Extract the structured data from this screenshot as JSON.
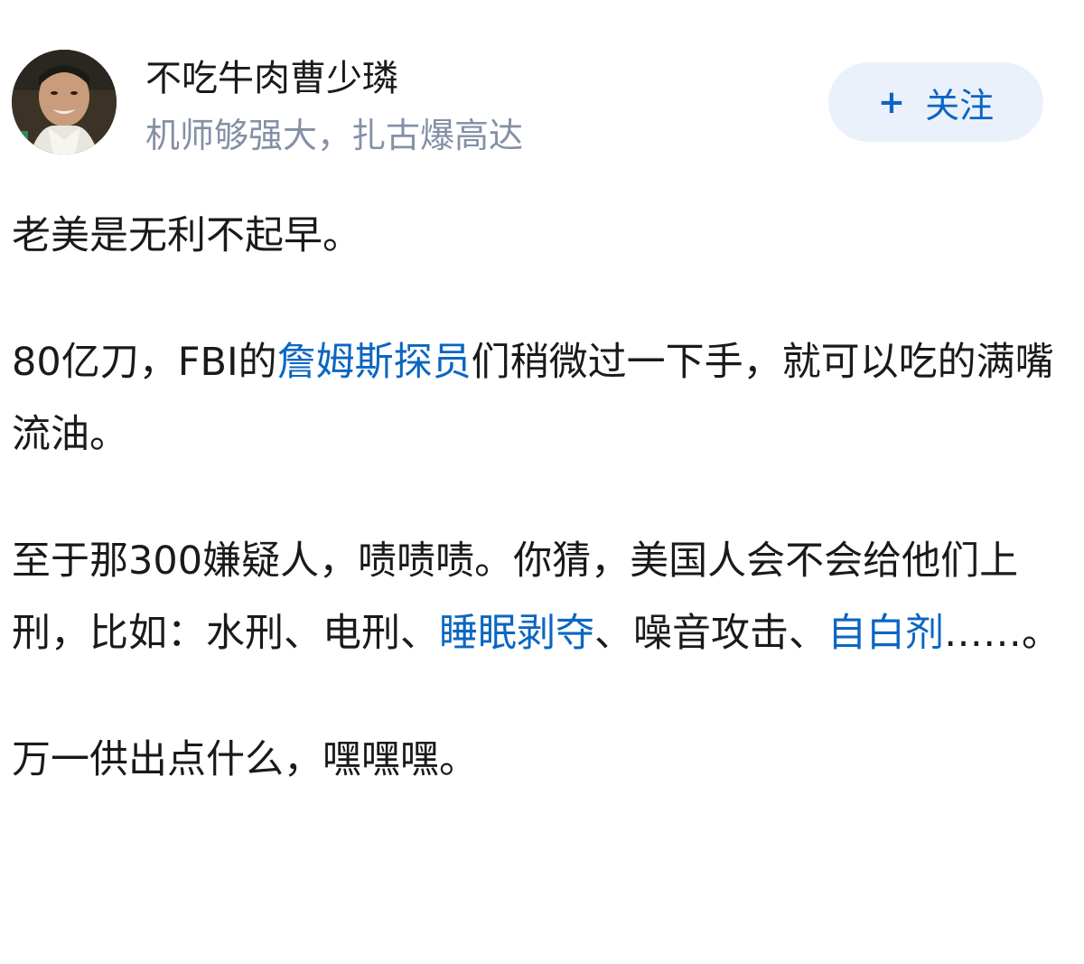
{
  "author": {
    "name": "不吃牛肉曹少璘",
    "bio": "机师够强大，扎古爆高达"
  },
  "follow_button": {
    "plus": "+",
    "label": "关注"
  },
  "colors": {
    "link": "#0a66c2",
    "follow_bg": "#ebf1fb",
    "bio_text": "#8590a6",
    "body_text": "#1a1a1a"
  },
  "answer": {
    "p1": "老美是无利不起早。",
    "p2": {
      "pre": "80亿刀，FBI的",
      "link1": "詹姆斯探员",
      "post": "们稍微过一下手，就可以吃的满嘴流油。"
    },
    "p3": {
      "seg1": "至于那300嫌疑人，啧啧啧。你猜，美国人会不会给他们上刑，比如：水刑、电刑、",
      "link1": "睡眠剥夺",
      "seg2": "、噪音攻击、",
      "link2": "自白剂",
      "seg3": "……。"
    },
    "p4": "万一供出点什么，嘿嘿嘿。"
  }
}
